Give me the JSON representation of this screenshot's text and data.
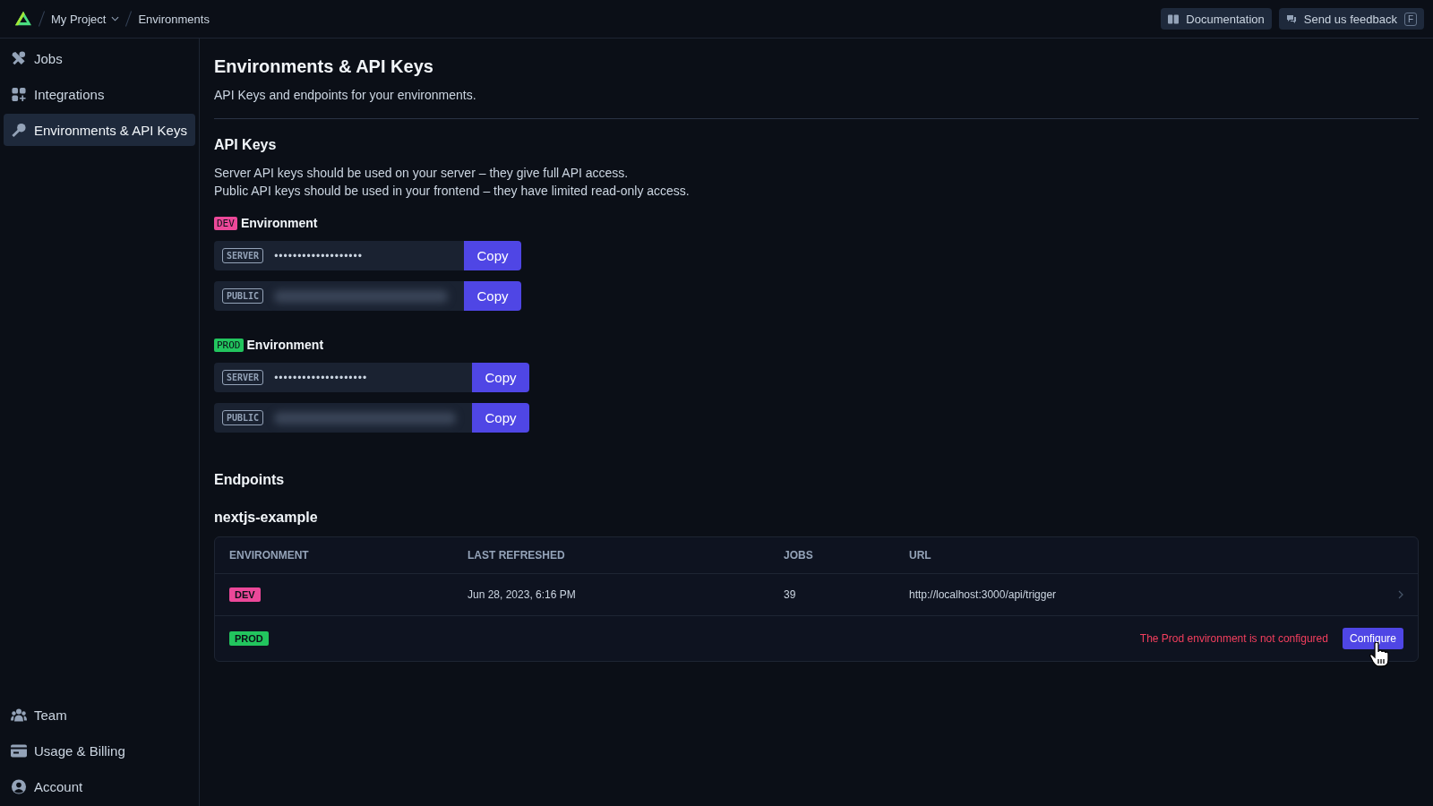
{
  "topbar": {
    "breadcrumbs": [
      {
        "label": "My Project",
        "dropdown": true
      },
      {
        "label": "Environments",
        "dropdown": false
      }
    ],
    "buttons": [
      {
        "label": "Documentation"
      },
      {
        "label": "Send us feedback",
        "shortcut": "F"
      }
    ]
  },
  "sidebar": {
    "items": [
      {
        "label": "Jobs",
        "selected": false
      },
      {
        "label": "Integrations",
        "selected": false
      },
      {
        "label": "Environments & API Keys",
        "selected": true
      }
    ],
    "footer_items": [
      {
        "label": "Team",
        "selected": false
      },
      {
        "label": "Usage & Billing",
        "selected": false
      },
      {
        "label": "Account",
        "selected": false
      }
    ]
  },
  "page": {
    "title": "Environments & API Keys",
    "subtitle": "API Keys and endpoints for your environments."
  },
  "api_keys": {
    "heading": "API Keys",
    "description": [
      "Server API keys should be used on your server – they give full API access.",
      "Public API keys should be used in your frontend – they have limited read-only access."
    ],
    "environments": [
      {
        "badge": "DEV",
        "color": "#ec4899",
        "label": "Environment",
        "keys": [
          {
            "type": "SERVER",
            "kind": "masked",
            "value": "•••••••••••••••••••",
            "button": "Copy"
          },
          {
            "type": "PUBLIC",
            "kind": "blurred",
            "button": "Copy"
          }
        ]
      },
      {
        "badge": "PROD",
        "color": "#22c55e",
        "label": "Environment",
        "keys": [
          {
            "type": "SERVER",
            "kind": "masked",
            "value": "••••••••••••••••••••",
            "button": "Copy"
          },
          {
            "type": "PUBLIC",
            "kind": "blurred",
            "button": "Copy"
          }
        ]
      }
    ]
  },
  "endpoints": {
    "heading": "Endpoints",
    "project": "nextjs-example",
    "columns": [
      "ENVIRONMENT",
      "LAST REFRESHED",
      "JOBS",
      "URL"
    ],
    "rows": [
      {
        "kind": "configured",
        "env": "DEV",
        "color": "#ec4899",
        "last_refreshed": "Jun 28, 2023, 6:16 PM",
        "jobs": "39",
        "url": "http://localhost:3000/api/trigger"
      },
      {
        "kind": "unconfigured",
        "env": "PROD",
        "color": "#22c55e",
        "message": "The Prod environment is not configured",
        "action": "Configure"
      }
    ]
  }
}
